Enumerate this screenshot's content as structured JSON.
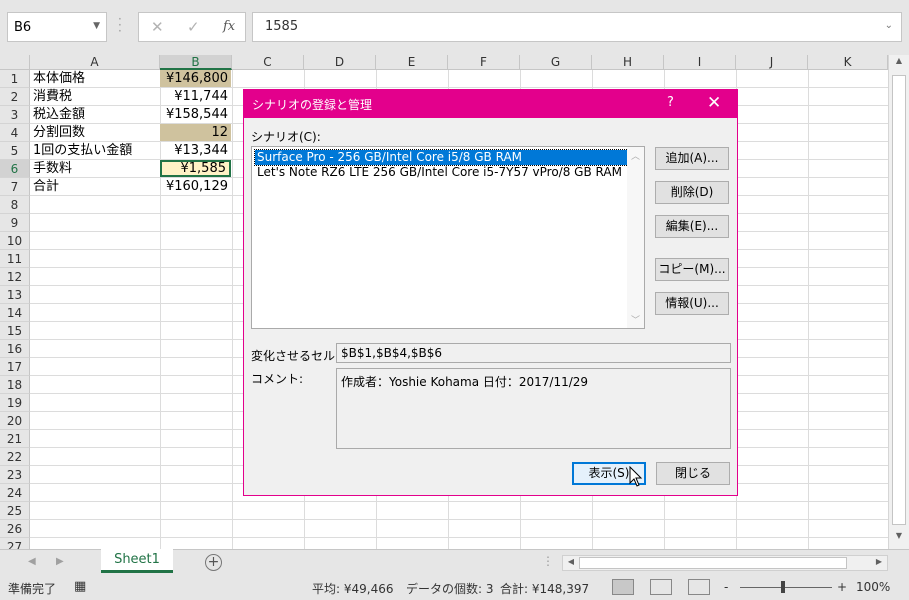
{
  "formula_bar": {
    "name_box": "B6",
    "cancel_icon": "✕",
    "enter_icon": "✓",
    "fx_label": "fx",
    "value": "1585"
  },
  "columns": [
    "A",
    "B",
    "C",
    "D",
    "E",
    "F",
    "G",
    "H",
    "I",
    "J",
    "K"
  ],
  "rows": [
    "1",
    "2",
    "3",
    "4",
    "5",
    "6",
    "7",
    "8",
    "9",
    "10",
    "11",
    "12",
    "13",
    "14",
    "15",
    "16",
    "17",
    "18",
    "19",
    "20",
    "21",
    "22",
    "23",
    "24",
    "25",
    "26",
    "27"
  ],
  "cells": [
    {
      "label": "本体価格",
      "value": "¥146,800"
    },
    {
      "label": "消費税",
      "value": "¥11,744"
    },
    {
      "label": "税込金額",
      "value": "¥158,544"
    },
    {
      "label": "分割回数",
      "value": "12"
    },
    {
      "label": "1回の支払い金額",
      "value": "¥13,344"
    },
    {
      "label": "手数料",
      "value": "¥1,585"
    },
    {
      "label": "合計",
      "value": "¥160,129"
    }
  ],
  "sheet_tab": "Sheet1",
  "add_sheet": "+",
  "status": {
    "ready": "準備完了",
    "average": "平均: ¥49,466",
    "count": "データの個数: 3",
    "sum": "合計: ¥148,397",
    "zoom_minus": "-",
    "zoom_plus": "+",
    "zoom": "100%"
  },
  "dialog": {
    "title": "シナリオの登録と管理",
    "help": "?",
    "close": "✕",
    "scenarios_label": "シナリオ(C):",
    "scenarios": [
      "Surface Pro - 256 GB/Intel Core i5/8 GB RAM",
      "Let's Note RZ6 LTE 256 GB/Intel Core i5-7Y57 vPro/8 GB RAM"
    ],
    "buttons": {
      "add": "追加(A)...",
      "delete": "削除(D)",
      "edit": "編集(E)...",
      "copy": "コピー(M)...",
      "info": "情報(U)...",
      "show": "表示(S)",
      "close": "閉じる"
    },
    "changing_cells_label": "変化させるセル:",
    "changing_cells": "$B$1,$B$4,$B$6",
    "comment_label": "コメント:",
    "comment": "作成者：Yoshie Kohama 日付：2017/11/29"
  },
  "colors": {
    "accent": "#217346",
    "dialog_title": "#e3008c",
    "selection": "#0078d7"
  }
}
